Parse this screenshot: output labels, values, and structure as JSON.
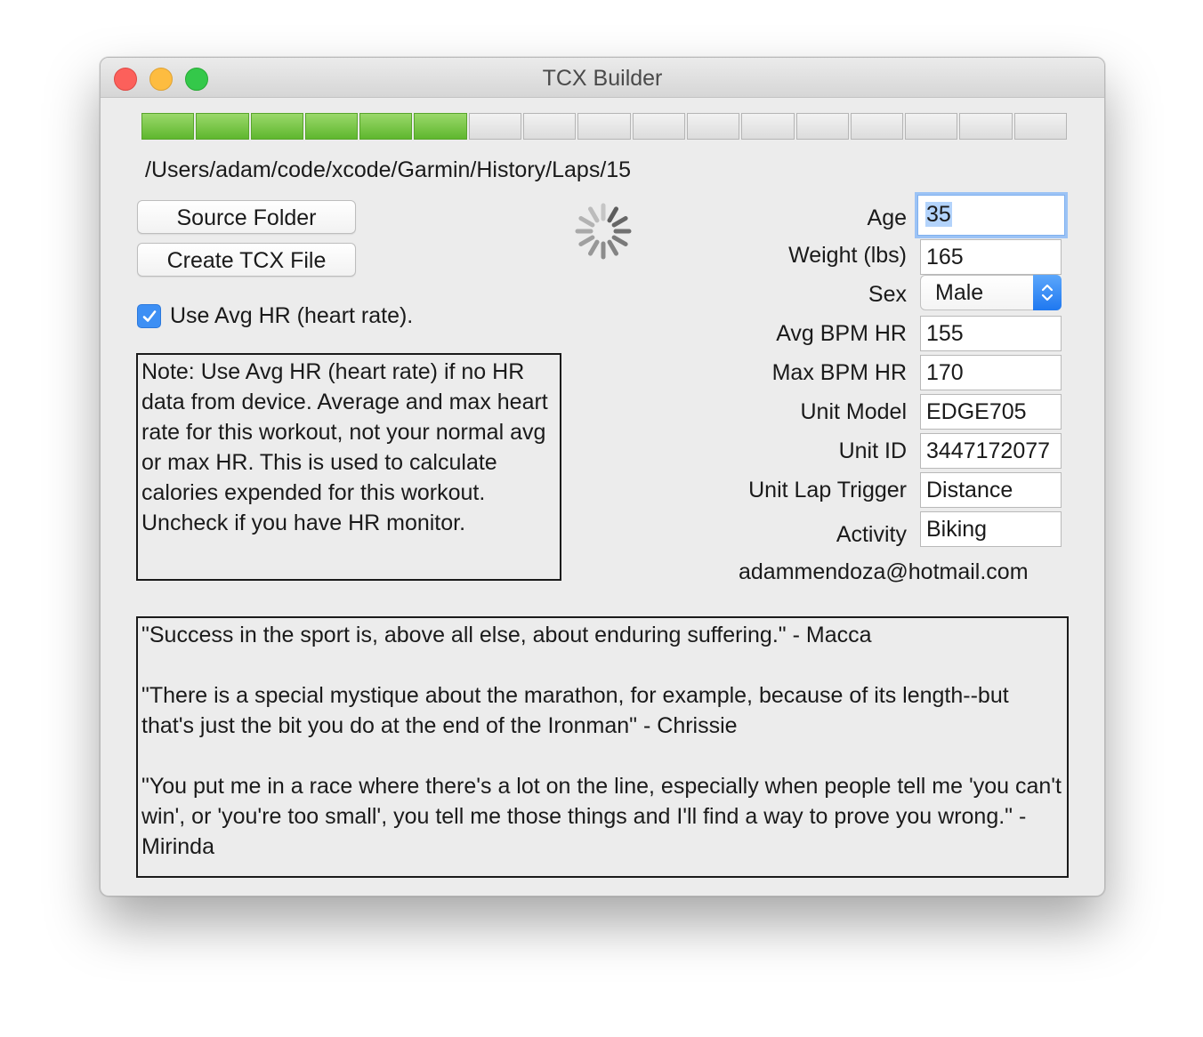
{
  "window": {
    "title": "TCX Builder"
  },
  "progress": {
    "total_segments": 17,
    "filled_segments": 6,
    "filled_color": "#6cc13a"
  },
  "path": "/Users/adam/code/xcode/Garmin/History/Laps/15",
  "buttons": {
    "source_folder": "Source Folder",
    "create_tcx": "Create TCX File"
  },
  "checkbox": {
    "label": "Use Avg HR (heart rate).",
    "checked": true
  },
  "note": "Note: Use Avg HR (heart rate) if no HR data from device. Average and max heart rate for this workout, not your normal avg or max HR. This is used to calculate calories expended for this workout. Uncheck if you have HR monitor.",
  "form": {
    "age_label": "Age",
    "age": "35",
    "weight_label": "Weight (lbs)",
    "weight": "165",
    "sex_label": "Sex",
    "sex": "Male",
    "avg_bpm_label": "Avg BPM HR",
    "avg_bpm": "155",
    "max_bpm_label": "Max BPM HR",
    "max_bpm": "170",
    "unit_model_label": "Unit Model",
    "unit_model": "EDGE705",
    "unit_id_label": "Unit ID",
    "unit_id": "3447172077",
    "lap_trigger_label": "Unit Lap Trigger",
    "lap_trigger": "Distance",
    "activity_label": "Activity",
    "activity": "Biking"
  },
  "email": "adammendoza@hotmail.com",
  "quotes": [
    "\"Success in the sport is, above all else, about enduring suffering.\" - Macca",
    "\"There is a special mystique about the marathon, for example, because of its length--but that's just the bit you do at the end of the Ironman\" - Chrissie",
    "\"You put me in a race where there's a lot on the line, especially when people tell me 'you can't win', or 'you're too small', you tell me those things and I'll find a way to prove you wrong.\" - Mirinda"
  ],
  "colors": {
    "accent": "#3d8ff4",
    "close": "#fc605b",
    "minimize": "#fdbc40",
    "maximize": "#34c84a"
  },
  "icons": {
    "spinner": "activity-spinner-icon",
    "check": "checkmark-icon",
    "updown": "chevron-updown-icon"
  }
}
